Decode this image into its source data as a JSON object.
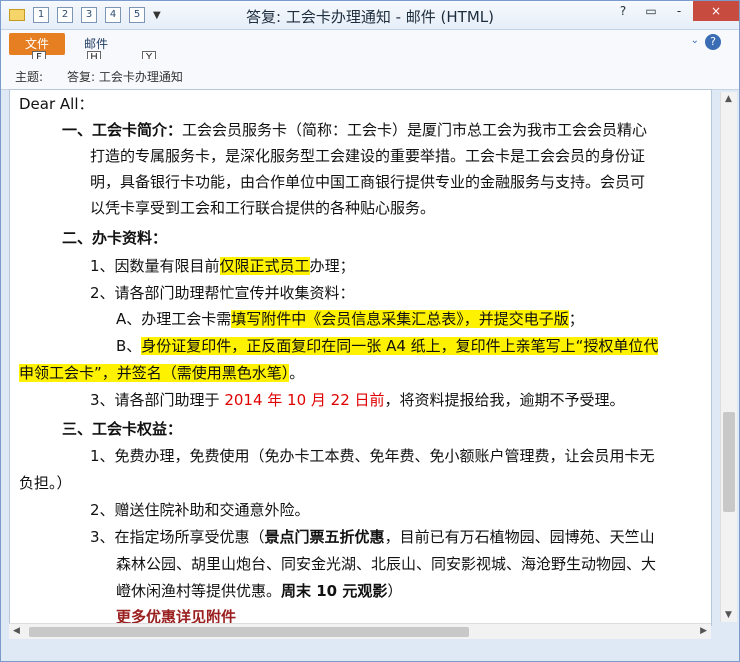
{
  "window": {
    "title": "答复: 工会卡办理通知 - 邮件 (HTML)",
    "qat": [
      "1",
      "2",
      "3",
      "4",
      "5"
    ],
    "controls": [
      "?",
      "▭",
      "-",
      "×"
    ]
  },
  "ribbon": {
    "tabs": [
      "文件",
      "邮件"
    ],
    "keytips": [
      "F",
      "H",
      "Y"
    ],
    "help": "?"
  },
  "subject": {
    "label": "主题:",
    "value": "答复: 工会卡办理通知"
  },
  "content": {
    "greeting": "Dear All：",
    "sec1_title": "一、工会卡简介：",
    "sec1_body": [
      "工会会员服务卡（简称：工会卡）是厦门市总工会为我市工会会员精心",
      "打造的专属服务卡，是深化服务型工会建设的重要举措。工会卡是工会会员的身份证",
      "明，具备银行卡功能，由合作单位中国工商银行提供专业的金融服务与支持。会员可",
      "以凭卡享受到工会和工行联合提供的各种贴心服务。"
    ],
    "sec2_title": "二、办卡资料：",
    "sec2_item1_pre": "1、因数量有限目前",
    "sec2_item1_hl": "仅限正式员工",
    "sec2_item1_post": "办理；",
    "sec2_item2": "2、请各部门助理帮忙宣传并收集资料：",
    "sec2_a_pre": "A、办理工会卡需",
    "sec2_a_hl": "填写附件中《会员信息采集汇总表》，并提交电子版",
    "sec2_a_post": "；",
    "sec2_b_pre": "B、",
    "sec2_b_hl1": "身份证复印件，正反面复印在同一张 A4 纸上，复印件上亲笔写上“授权单位代",
    "sec2_b_hl2": "申领工会卡”，并签名（需使用黑色水笔）",
    "sec2_b_post": "。",
    "sec2_item3_pre": "3、请各部门助理于 ",
    "sec2_item3_red": "2014 年 10 月 22 日前",
    "sec2_item3_post": "，将资料提报给我，逾期不予受理。",
    "sec3_title": "三、工会卡权益：",
    "sec3_item1a": "1、免费办理，免费使用（免办卡工本费、免年费、免小额账户管理费，让会员用卡无",
    "sec3_item1b": "负担。）",
    "sec3_item2": "2、赠送住院补助和交通意外险。",
    "sec3_item3_pre": "3、在指定场所享受优惠（",
    "sec3_item3_bold": "景点门票五折优惠",
    "sec3_item3_post": "，目前已有万石植物园、园博苑、天竺山",
    "sec3_item3b": "森林公园、胡里山炮台、同安金光湖、北辰山、同安影视城、海沧野生动物园、大",
    "sec3_item3c_pre": "嶝休闲渔村等提供优惠。",
    "sec3_item3c_bold": "周末 10 元观影",
    "sec3_item3c_post": "）",
    "sec3_more": "更多优惠详见附件"
  }
}
